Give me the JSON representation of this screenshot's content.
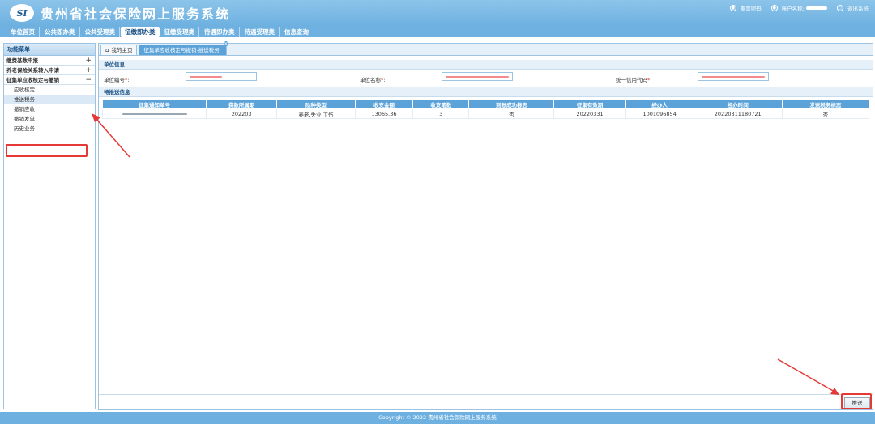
{
  "header": {
    "logo_abbr": "SI",
    "title": "贵州省社会保险网上服务系统",
    "reset_password": "重置密码",
    "account_label": "账户名称:",
    "logout": "退出系统"
  },
  "menubar": {
    "items": [
      "单位首页",
      "公共即办类",
      "公共受理类",
      "征缴即办类",
      "征缴受理类",
      "待遇即办类",
      "待遇受理类",
      "信息查询"
    ],
    "active_index": 3
  },
  "sidebar": {
    "title": "功能菜单",
    "groups": [
      {
        "label": "缴费基数申报",
        "toggle": "+"
      },
      {
        "label": "养老保险关系转入申请",
        "toggle": "+"
      },
      {
        "label": "征集单应收核定与撤销",
        "toggle": "−"
      }
    ],
    "subitems": [
      "应收核定",
      "推送税务",
      "撤销应收",
      "撤销发单",
      "历史业务"
    ],
    "active_sub": "推送税务"
  },
  "tabs": {
    "home": "我的主页",
    "active": "征集单应收核定与撤销-推送税务"
  },
  "unit_info": {
    "section": "单位信息",
    "unit_no_label": "单位编号",
    "unit_name_label": "单位名称",
    "credit_code_label": "统一信用代码"
  },
  "push_info": {
    "section": "待推送信息",
    "columns": [
      "征集通知单号",
      "费款所属期",
      "险种类型",
      "收支金额",
      "收支笔数",
      "到账成功标志",
      "征集有效期",
      "经办人",
      "经办时间",
      "发送税务标志"
    ],
    "rows": [
      [
        "",
        "202203",
        "养老,失业,工伤",
        "13065.36",
        "3",
        "否",
        "20220331",
        "1001096854",
        "20220311180721",
        "否"
      ]
    ]
  },
  "actions": {
    "push_button": "推送"
  },
  "footer": {
    "text": "Copyright  ©  2022  贵州省社会保险网上服务系统"
  },
  "colors": {
    "header_blue": "#6eb1e0",
    "table_header": "#5aa2d8",
    "annotation_red": "#e53935"
  }
}
